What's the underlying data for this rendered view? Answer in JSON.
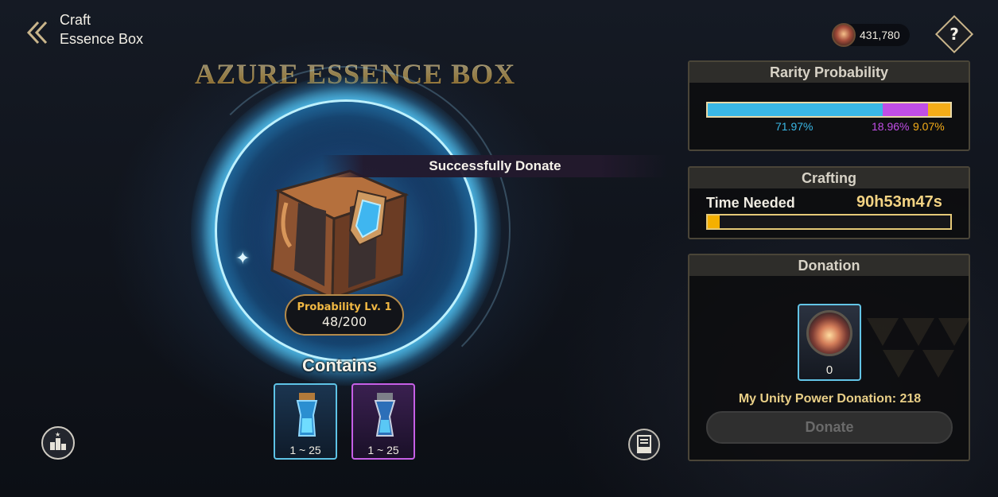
{
  "header": {
    "breadcrumb_parent": "Craft",
    "breadcrumb_current": "Essence Box",
    "currency_value": "431,780",
    "help_label": "?"
  },
  "box": {
    "title": "AZURE ESSENCE BOX",
    "toast": "Successfully Donate",
    "probability_label": "Probability Lv. 1",
    "probability_progress": "48/200",
    "contains_label": "Contains",
    "items": [
      {
        "range": "1 ~ 25",
        "rarity_color": "#5ec3e6"
      },
      {
        "range": "1 ~ 25",
        "rarity_color": "#c65fe6"
      }
    ]
  },
  "rarity_panel": {
    "title": "Rarity Probability",
    "segments": [
      {
        "label": "71.97%",
        "value": 71.97,
        "color": "#3ab8e6"
      },
      {
        "label": "18.96%",
        "value": 18.96,
        "color": "#c14ee6"
      },
      {
        "label": "9.07%",
        "value": 9.07,
        "color": "#f5ad18"
      }
    ]
  },
  "crafting_panel": {
    "title": "Crafting",
    "time_label": "Time Needed",
    "time_value": "90h53m47s",
    "progress_fraction": 0.05
  },
  "donation_panel": {
    "title": "Donation",
    "item_count": "0",
    "unity_text": "My Unity Power Donation: 218",
    "donate_label": "Donate"
  },
  "icons": {
    "back": "chevron-left-icon",
    "currency": "unity-orb-icon",
    "help": "help-icon",
    "ranking": "ranking-icon",
    "log": "log-icon"
  }
}
